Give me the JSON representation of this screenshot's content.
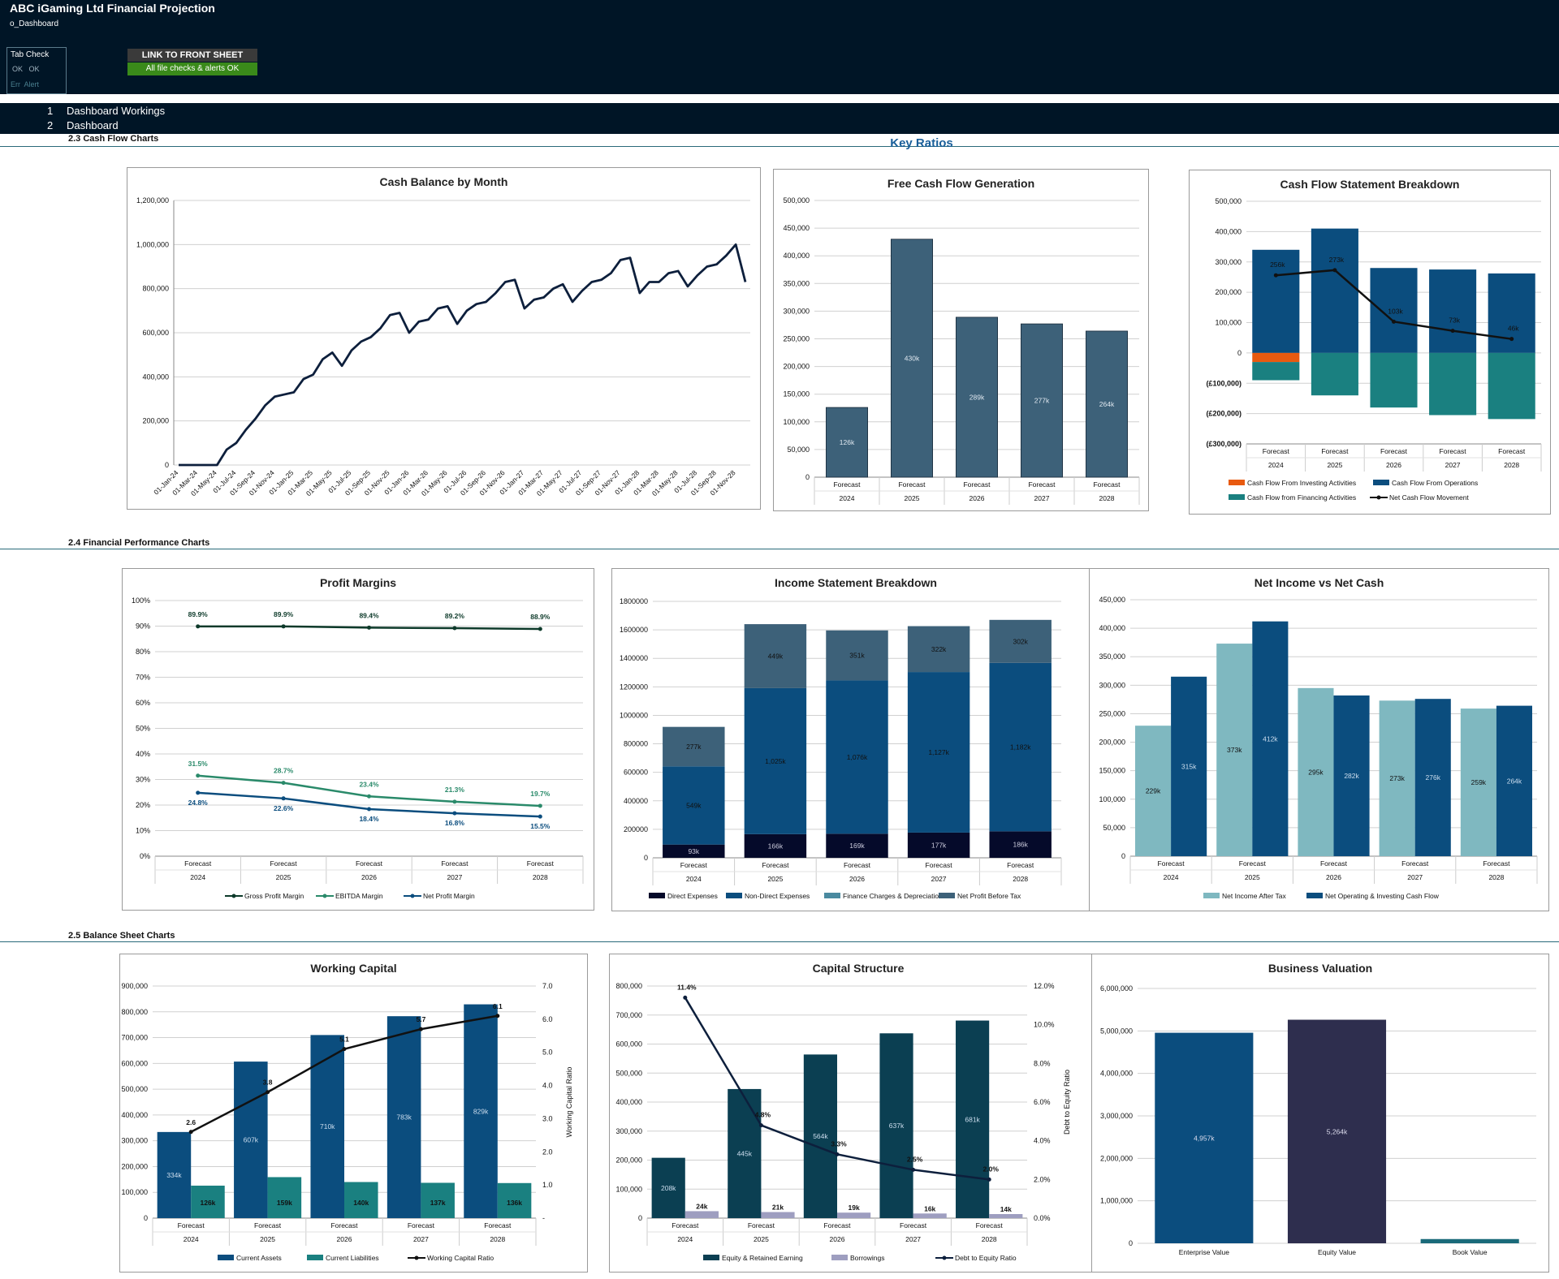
{
  "header": {
    "title": "ABC iGaming Ltd Financial Projection",
    "sheet": "o_Dashboard",
    "tab_check": {
      "title": "Tab Check",
      "row1": "OK   OK",
      "row2": "Err  Alert"
    },
    "front_button": "LINK TO FRONT SHEET",
    "status": "All file checks & alerts OK"
  },
  "nav": {
    "items": [
      {
        "num": "1",
        "label": "Dashboard Workings"
      },
      {
        "num": "2",
        "label": "Dashboard"
      }
    ]
  },
  "sections": {
    "s23": "2.3   Cash Flow Charts",
    "s24": "2.4   Financial Performance Charts",
    "s25": "2.5   Balance Sheet Charts",
    "key_ratios": "Key Ratios"
  },
  "colors": {
    "navy": "#001526",
    "line": "#0d1f3c",
    "fcf": "#3d6179",
    "blue": "#0b4d7e",
    "teal": "#1a8080",
    "orange": "#e85a10",
    "darkteal": "#0b3f52",
    "lightteal": "#7fb8c0",
    "green": "#2a8a6a",
    "lavender": "#9e9ec0",
    "purple": "#2e2e4e"
  },
  "chart_data": [
    {
      "id": "cash_balance",
      "type": "line",
      "title": "Cash Balance by Month",
      "ylim": [
        0,
        1200000
      ],
      "yticks": [
        "0",
        "200,000",
        "400,000",
        "600,000",
        "800,000",
        "1,000,000",
        "1,200,000"
      ],
      "xlabels": [
        "01-Jan-24",
        "01-Mar-24",
        "01-May-24",
        "01-Jul-24",
        "01-Sep-24",
        "01-Nov-24",
        "01-Jan-25",
        "01-Mar-25",
        "01-May-25",
        "01-Jul-25",
        "01-Sep-25",
        "01-Nov-25",
        "01-Jan-26",
        "01-Mar-26",
        "01-May-26",
        "01-Jul-26",
        "01-Sep-26",
        "01-Nov-26",
        "01-Jan-27",
        "01-Mar-27",
        "01-May-27",
        "01-Jul-27",
        "01-Sep-27",
        "01-Nov-27",
        "01-Jan-28",
        "01-Mar-28",
        "01-May-28",
        "01-Jul-28",
        "01-Sep-28",
        "01-Nov-28"
      ],
      "values": [
        0,
        0,
        0,
        0,
        0,
        70000,
        100000,
        160000,
        210000,
        270000,
        310000,
        320000,
        330000,
        390000,
        410000,
        480000,
        510000,
        450000,
        520000,
        560000,
        580000,
        620000,
        680000,
        690000,
        600000,
        650000,
        660000,
        710000,
        720000,
        640000,
        700000,
        730000,
        740000,
        780000,
        830000,
        840000,
        710000,
        750000,
        760000,
        800000,
        820000,
        740000,
        790000,
        830000,
        840000,
        870000,
        930000,
        940000,
        780000,
        830000,
        830000,
        870000,
        880000,
        810000,
        860000,
        900000,
        910000,
        950000,
        1000000,
        830000
      ]
    },
    {
      "id": "fcf",
      "type": "bar",
      "title": "Free Cash Flow Generation",
      "ylim": [
        0,
        500000
      ],
      "yticks": [
        "0",
        "50,000",
        "100,000",
        "150,000",
        "200,000",
        "250,000",
        "300,000",
        "350,000",
        "400,000",
        "450,000",
        "500,000"
      ],
      "categories": [
        "2024",
        "2025",
        "2026",
        "2027",
        "2028"
      ],
      "category_prefix": "Forecast",
      "values": [
        126000,
        430000,
        289000,
        277000,
        264000
      ],
      "labels": [
        "126k",
        "430k",
        "289k",
        "277k",
        "264k"
      ]
    },
    {
      "id": "cfs_breakdown",
      "type": "bar",
      "title": "Cash Flow Statement Breakdown",
      "ylim": [
        -300000,
        500000
      ],
      "yticks": [
        "(£300,000)",
        "(£200,000)",
        "(£100,000)",
        "0",
        "100,000",
        "200,000",
        "300,000",
        "400,000",
        "500,000"
      ],
      "categories": [
        "2024",
        "2025",
        "2026",
        "2027",
        "2028"
      ],
      "category_prefix": "Forecast",
      "series": [
        {
          "name": "Cash Flow From Investing Activities",
          "values": [
            -30000,
            0,
            0,
            0,
            0
          ]
        },
        {
          "name": "Cash Flow From Operations",
          "values": [
            340000,
            410000,
            280000,
            275000,
            262000
          ]
        },
        {
          "name": "Cash Flow from Financing Activities",
          "values": [
            -60000,
            -140000,
            -180000,
            -205000,
            -218000
          ]
        },
        {
          "name": "Net Cash Flow Movement",
          "values": [
            256000,
            273000,
            103000,
            73000,
            46000
          ]
        }
      ],
      "labels": [
        "256k",
        "273k",
        "103k",
        "73k",
        "46k"
      ]
    },
    {
      "id": "profit_margins",
      "type": "line",
      "title": "Profit Margins",
      "ylim": [
        0,
        100
      ],
      "yticks": [
        "0%",
        "10%",
        "20%",
        "30%",
        "40%",
        "50%",
        "60%",
        "70%",
        "80%",
        "90%",
        "100%"
      ],
      "categories": [
        "2024",
        "2025",
        "2026",
        "2027",
        "2028"
      ],
      "category_prefix": "Forecast",
      "series": [
        {
          "name": "Gross Profit Margin",
          "values": [
            89.9,
            89.9,
            89.4,
            89.2,
            88.9
          ],
          "labels": [
            "89.9%",
            "89.9%",
            "89.4%",
            "89.2%",
            "88.9%"
          ]
        },
        {
          "name": "EBITDA Margin",
          "values": [
            31.5,
            28.7,
            23.4,
            21.3,
            19.7
          ],
          "labels": [
            "31.5%",
            "28.7%",
            "23.4%",
            "21.3%",
            "19.7%"
          ]
        },
        {
          "name": "Net Profit Margin",
          "values": [
            24.8,
            22.6,
            18.4,
            16.8,
            15.5
          ],
          "labels": [
            "24.8%",
            "22.6%",
            "18.4%",
            "16.8%",
            "15.5%"
          ]
        }
      ]
    },
    {
      "id": "income_statement",
      "type": "bar",
      "title": "Income Statement Breakdown",
      "ylim": [
        0,
        1800000
      ],
      "yticks": [
        "0",
        "200000",
        "400000",
        "600000",
        "800000",
        "1000000",
        "1200000",
        "1400000",
        "1600000",
        "1800000"
      ],
      "categories": [
        "2024",
        "2025",
        "2026",
        "2027",
        "2028"
      ],
      "category_prefix": "Forecast",
      "series": [
        {
          "name": "Direct Expenses",
          "values": [
            93000,
            166000,
            169000,
            177000,
            186000
          ],
          "labels": [
            "93k",
            "166k",
            "169k",
            "177k",
            "186k"
          ]
        },
        {
          "name": "Non-Direct Expenses",
          "values": [
            549000,
            1025000,
            1076000,
            1127000,
            1182000
          ],
          "labels": [
            "549k",
            "1,025k",
            "1,076k",
            "1,127k",
            "1,182k"
          ]
        },
        {
          "name": "Finance Charges & Depreciation",
          "values": [
            0,
            0,
            0,
            0,
            0
          ],
          "labels": [
            "",
            "",
            "",
            "",
            ""
          ]
        },
        {
          "name": "Net Profit Before Tax",
          "values": [
            277000,
            449000,
            351000,
            322000,
            302000
          ],
          "labels": [
            "277k",
            "449k",
            "351k",
            "322k",
            "302k"
          ]
        }
      ]
    },
    {
      "id": "net_income_cash",
      "type": "bar",
      "title": "Net Income vs Net Cash",
      "ylim": [
        0,
        450000
      ],
      "yticks": [
        "0",
        "50,000",
        "100,000",
        "150,000",
        "200,000",
        "250,000",
        "300,000",
        "350,000",
        "400,000",
        "450,000"
      ],
      "categories": [
        "2024",
        "2025",
        "2026",
        "2027",
        "2028"
      ],
      "category_prefix": "Forecast",
      "series": [
        {
          "name": "Net Income After Tax",
          "values": [
            229000,
            373000,
            295000,
            273000,
            259000
          ],
          "labels": [
            "229k",
            "373k",
            "295k",
            "273k",
            "259k"
          ]
        },
        {
          "name": "Net Operating & Investing Cash Flow",
          "values": [
            315000,
            412000,
            282000,
            276000,
            264000
          ],
          "labels": [
            "315k",
            "412k",
            "282k",
            "276k",
            "264k"
          ]
        }
      ]
    },
    {
      "id": "working_capital",
      "type": "bar",
      "title": "Working Capital",
      "ylim": [
        0,
        900000
      ],
      "y2lim": [
        0,
        7
      ],
      "y2label": "Working Capital Ratio",
      "yticks": [
        "0",
        "100,000",
        "200,000",
        "300,000",
        "400,000",
        "500,000",
        "600,000",
        "700,000",
        "800,000",
        "900,000"
      ],
      "y2ticks": [
        "-",
        "1.0",
        "2.0",
        "3.0",
        "4.0",
        "5.0",
        "6.0",
        "7.0"
      ],
      "categories": [
        "2024",
        "2025",
        "2026",
        "2027",
        "2028"
      ],
      "category_prefix": "Forecast",
      "series": [
        {
          "name": "Current Assets",
          "values": [
            334000,
            607000,
            710000,
            783000,
            829000
          ],
          "labels": [
            "334k",
            "607k",
            "710k",
            "783k",
            "829k"
          ]
        },
        {
          "name": "Current Liabilities",
          "values": [
            126000,
            159000,
            140000,
            137000,
            136000
          ],
          "labels": [
            "126k",
            "159k",
            "140k",
            "137k",
            "136k"
          ]
        },
        {
          "name": "Working Capital Ratio",
          "values": [
            2.6,
            3.8,
            5.1,
            5.7,
            6.1
          ],
          "labels": [
            "2.6",
            "3.8",
            "5.1",
            "5.7",
            "6.1"
          ]
        }
      ]
    },
    {
      "id": "capital_structure",
      "type": "bar",
      "title": "Capital Structure",
      "ylim": [
        0,
        800000
      ],
      "y2lim": [
        0,
        12
      ],
      "y2label": "Debt to Equity Ratio",
      "yticks": [
        "0",
        "100,000",
        "200,000",
        "300,000",
        "400,000",
        "500,000",
        "600,000",
        "700,000",
        "800,000"
      ],
      "y2ticks": [
        "0.0%",
        "2.0%",
        "4.0%",
        "6.0%",
        "8.0%",
        "10.0%",
        "12.0%"
      ],
      "categories": [
        "2024",
        "2025",
        "2026",
        "2027",
        "2028"
      ],
      "category_prefix": "Forecast",
      "series": [
        {
          "name": "Equity & Retained Earning",
          "values": [
            208000,
            445000,
            564000,
            637000,
            681000
          ],
          "labels": [
            "208k",
            "445k",
            "564k",
            "637k",
            "681k"
          ]
        },
        {
          "name": "Borrowings",
          "values": [
            24000,
            21000,
            19000,
            16000,
            14000
          ],
          "labels": [
            "24k",
            "21k",
            "19k",
            "16k",
            "14k"
          ]
        },
        {
          "name": "Debt to Equity Ratio",
          "values": [
            11.4,
            4.8,
            3.3,
            2.5,
            2.0
          ],
          "labels": [
            "11.4%",
            "4.8%",
            "3.3%",
            "2.5%",
            "2.0%"
          ]
        }
      ]
    },
    {
      "id": "business_valuation",
      "type": "bar",
      "title": "Business Valuation",
      "ylim": [
        0,
        6000000
      ],
      "yticks": [
        "0",
        "1,000,000",
        "2,000,000",
        "3,000,000",
        "4,000,000",
        "5,000,000",
        "6,000,000"
      ],
      "categories": [
        "Enterprise Value",
        "Equity Value",
        "Book Value"
      ],
      "values": [
        4957000,
        5264000,
        100000
      ],
      "labels": [
        "4,957k",
        "5,264k",
        ""
      ]
    }
  ]
}
